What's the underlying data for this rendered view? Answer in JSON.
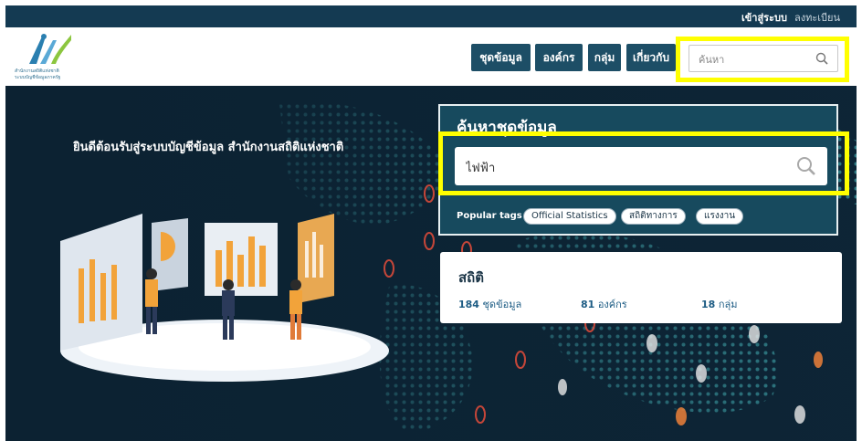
{
  "topbar": {
    "login": "เข้าสู่ระบบ",
    "register": "ลงทะเบียน"
  },
  "logo": {
    "line1": "สำนักงานสถิติแห่งชาติ",
    "line2": "ระบบบัญชีข้อมูลภาครัฐ"
  },
  "nav": {
    "datasets": "ชุดข้อมูล",
    "orgs": "องค์กร",
    "groups": "กลุ่ม",
    "about": "เกี่ยวกับ"
  },
  "top_search": {
    "placeholder": "ค้นหา",
    "icon": "search-icon"
  },
  "hero": {
    "welcome": "ยินดีต้อนรับสู่ระบบบัญชีข้อมูล สำนักงานสถิติแห่งชาติ"
  },
  "search_panel": {
    "title": "ค้นหาชุดข้อมูล",
    "value": "ไฟฟ้า",
    "popular_label": "Popular tags",
    "tags": [
      "Official Statistics",
      "สถิติทางการ",
      "แรงงาน"
    ]
  },
  "stats": {
    "title": "สถิติ",
    "datasets_count": "184",
    "datasets_label": "ชุดข้อมูล",
    "orgs_count": "81",
    "orgs_label": "องค์กร",
    "groups_count": "18",
    "groups_label": "กลุ่ม"
  },
  "colors": {
    "topbar": "#143a52",
    "nav_button": "#1d4e66",
    "panel": "#174a5e",
    "highlight": "#ffff00",
    "link": "#1d5c84"
  }
}
